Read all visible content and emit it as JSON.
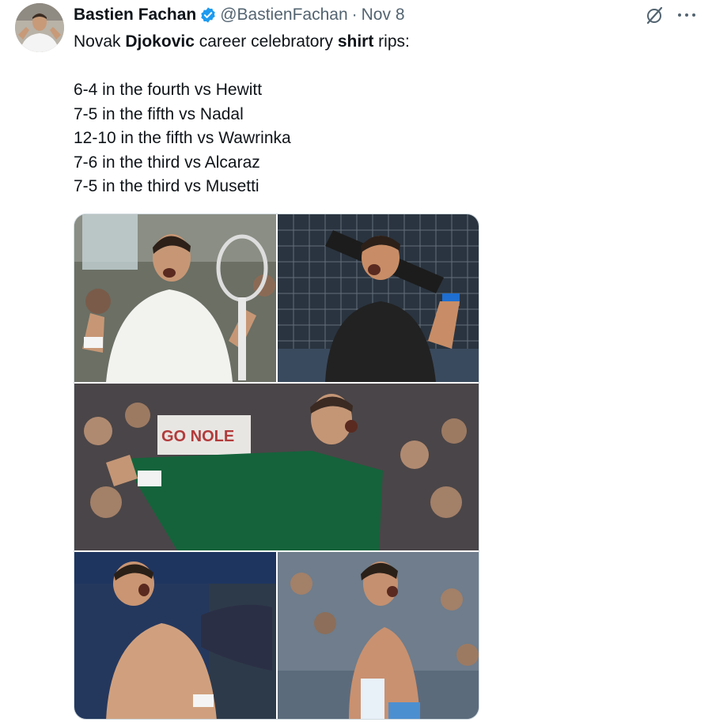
{
  "tweet": {
    "author_name": "Bastien Fachan",
    "handle": "@BastienFachan",
    "separator": "·",
    "date": "Nov 8",
    "text": {
      "intro_1": "Novak ",
      "intro_bold_1": "Djokovic",
      "intro_2": " career celebratory ",
      "intro_bold_2": "shirt",
      "intro_3": " rips:",
      "lines": [
        "6-4 in the fourth vs Hewitt",
        "7-5 in the fifth vs Nadal",
        "12-10 in the fifth vs Wawrinka",
        "7-6 in the third vs Alcaraz",
        "7-5 in the third vs Musetti"
      ]
    },
    "media": {
      "sign_text": "GO NOLE"
    }
  },
  "colors": {
    "text": "#0f1419",
    "secondary": "#536471",
    "verified": "#1d9bf0",
    "border": "#cfd9de"
  },
  "icons": [
    "verified-badge-icon",
    "grok-icon",
    "more-icon"
  ]
}
